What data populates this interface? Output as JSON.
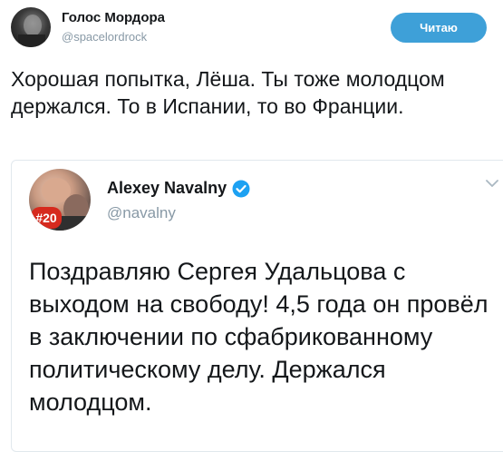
{
  "tweet": {
    "author": {
      "name": "Голос Мордора",
      "handle": "@spacelordrock"
    },
    "follow_label": "Читаю",
    "text": "Хорошая попытка, Лёша. Ты тоже молодцом держался. То в Испании, то во Франции."
  },
  "quoted": {
    "author": {
      "name": "Alexey Navalny",
      "handle": "@navalny",
      "avatar_badge": "#20"
    },
    "text": "Поздравляю Сергея Удальцова с выходом на свободу! 4,5 года он провёл в заключении по сфабрикованному политическому делу. Держался молодцом."
  },
  "colors": {
    "accent": "#3ea0d8",
    "verified": "#1da1f2",
    "muted": "#8899a6",
    "badge": "#d62a1e"
  },
  "icons": {
    "verified": "verified-icon",
    "caret": "chevron-down-icon"
  }
}
